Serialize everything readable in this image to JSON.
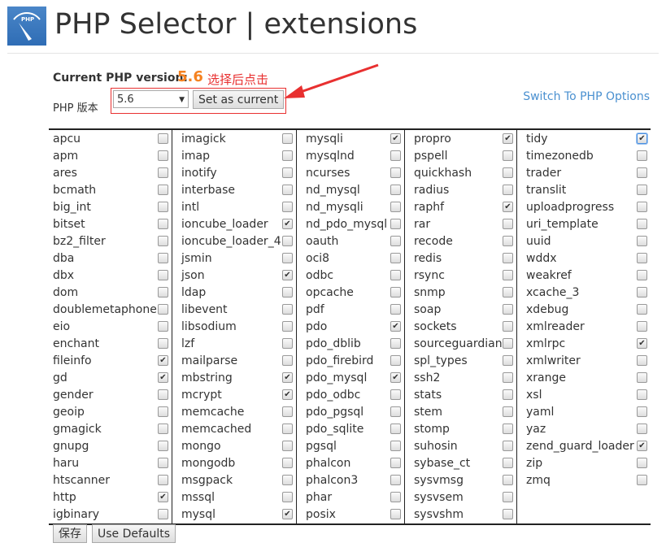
{
  "header": {
    "title": "PHP Selector | extensions",
    "logo_icon": "php-gauge-logo"
  },
  "version": {
    "label": "Current PHP version:",
    "value": "5.6",
    "annotation": "选择后点击",
    "php_label": "PHP 版本",
    "selected": "5.6",
    "set_current": "Set as current",
    "switch_link": "Switch To PHP Options"
  },
  "colors": {
    "accent": "#f58220",
    "link": "#4a90d0",
    "annotation": "#e83030"
  },
  "columns": [
    [
      [
        "apcu",
        0
      ],
      [
        "apm",
        0
      ],
      [
        "ares",
        0
      ],
      [
        "bcmath",
        0
      ],
      [
        "big_int",
        0
      ],
      [
        "bitset",
        0
      ],
      [
        "bz2_filter",
        0
      ],
      [
        "dba",
        0
      ],
      [
        "dbx",
        0
      ],
      [
        "dom",
        0
      ],
      [
        "doublemetaphone",
        0
      ],
      [
        "eio",
        0
      ],
      [
        "enchant",
        0
      ],
      [
        "fileinfo",
        1
      ],
      [
        "gd",
        1
      ],
      [
        "gender",
        0
      ],
      [
        "geoip",
        0
      ],
      [
        "gmagick",
        0
      ],
      [
        "gnupg",
        0
      ],
      [
        "haru",
        0
      ],
      [
        "htscanner",
        0
      ],
      [
        "http",
        1
      ],
      [
        "igbinary",
        0
      ]
    ],
    [
      [
        "imagick",
        0
      ],
      [
        "imap",
        0
      ],
      [
        "inotify",
        0
      ],
      [
        "interbase",
        0
      ],
      [
        "intl",
        0
      ],
      [
        "ioncube_loader",
        1
      ],
      [
        "ioncube_loader_4",
        0
      ],
      [
        "jsmin",
        0
      ],
      [
        "json",
        1
      ],
      [
        "ldap",
        0
      ],
      [
        "libevent",
        0
      ],
      [
        "libsodium",
        0
      ],
      [
        "lzf",
        0
      ],
      [
        "mailparse",
        0
      ],
      [
        "mbstring",
        1
      ],
      [
        "mcrypt",
        1
      ],
      [
        "memcache",
        0
      ],
      [
        "memcached",
        0
      ],
      [
        "mongo",
        0
      ],
      [
        "mongodb",
        0
      ],
      [
        "msgpack",
        0
      ],
      [
        "mssql",
        0
      ],
      [
        "mysql",
        1
      ]
    ],
    [
      [
        "mysqli",
        1
      ],
      [
        "mysqlnd",
        0
      ],
      [
        "ncurses",
        0
      ],
      [
        "nd_mysql",
        0
      ],
      [
        "nd_mysqli",
        0
      ],
      [
        "nd_pdo_mysql",
        0
      ],
      [
        "oauth",
        0
      ],
      [
        "oci8",
        0
      ],
      [
        "odbc",
        0
      ],
      [
        "opcache",
        0
      ],
      [
        "pdf",
        0
      ],
      [
        "pdo",
        1
      ],
      [
        "pdo_dblib",
        0
      ],
      [
        "pdo_firebird",
        0
      ],
      [
        "pdo_mysql",
        1
      ],
      [
        "pdo_odbc",
        0
      ],
      [
        "pdo_pgsql",
        0
      ],
      [
        "pdo_sqlite",
        0
      ],
      [
        "pgsql",
        0
      ],
      [
        "phalcon",
        0
      ],
      [
        "phalcon3",
        0
      ],
      [
        "phar",
        0
      ],
      [
        "posix",
        0
      ]
    ],
    [
      [
        "propro",
        1
      ],
      [
        "pspell",
        0
      ],
      [
        "quickhash",
        0
      ],
      [
        "radius",
        0
      ],
      [
        "raphf",
        1
      ],
      [
        "rar",
        0
      ],
      [
        "recode",
        0
      ],
      [
        "redis",
        0
      ],
      [
        "rsync",
        0
      ],
      [
        "snmp",
        0
      ],
      [
        "soap",
        0
      ],
      [
        "sockets",
        0
      ],
      [
        "sourceguardian",
        0
      ],
      [
        "spl_types",
        0
      ],
      [
        "ssh2",
        0
      ],
      [
        "stats",
        0
      ],
      [
        "stem",
        0
      ],
      [
        "stomp",
        0
      ],
      [
        "suhosin",
        0
      ],
      [
        "sybase_ct",
        0
      ],
      [
        "sysvmsg",
        0
      ],
      [
        "sysvsem",
        0
      ],
      [
        "sysvshm",
        0
      ]
    ],
    [
      [
        "tidy",
        1
      ],
      [
        "timezonedb",
        0
      ],
      [
        "trader",
        0
      ],
      [
        "translit",
        0
      ],
      [
        "uploadprogress",
        0
      ],
      [
        "uri_template",
        0
      ],
      [
        "uuid",
        0
      ],
      [
        "wddx",
        0
      ],
      [
        "weakref",
        0
      ],
      [
        "xcache_3",
        0
      ],
      [
        "xdebug",
        0
      ],
      [
        "xmlreader",
        0
      ],
      [
        "xmlrpc",
        1
      ],
      [
        "xmlwriter",
        0
      ],
      [
        "xrange",
        0
      ],
      [
        "xsl",
        0
      ],
      [
        "yaml",
        0
      ],
      [
        "yaz",
        0
      ],
      [
        "zend_guard_loader",
        1
      ],
      [
        "zip",
        0
      ],
      [
        "zmq",
        0
      ]
    ]
  ],
  "footer": {
    "save": "保存",
    "defaults": "Use Defaults"
  }
}
